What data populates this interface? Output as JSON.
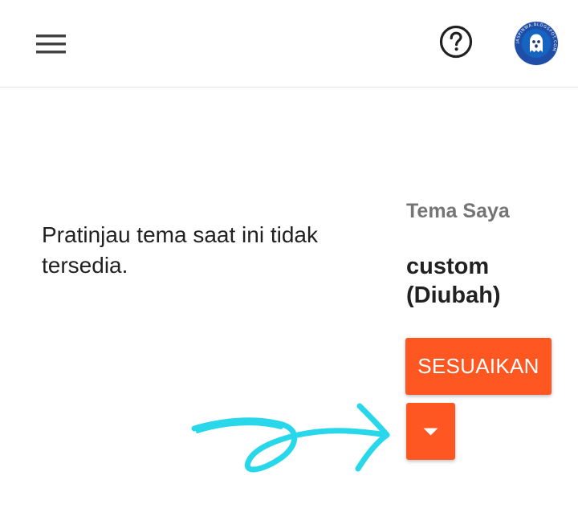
{
  "header": {
    "menu_icon": "hamburger-menu-icon",
    "help_icon": "help-circle-icon",
    "avatar": {
      "icon": "ghost-avatar-icon",
      "ring_text": "JASPINWA.BLOGSPOT.COM",
      "colors": {
        "ring": "#1e4ea8",
        "inner": "#1565c0"
      }
    }
  },
  "main": {
    "preview_message": "Pratinjau tema saat ini tidak tersedia."
  },
  "theme_panel": {
    "heading": "Tema Saya",
    "theme_name": "custom (Diubah)",
    "customize_label": "SESUAIKAN",
    "dropdown_icon": "caret-down-icon"
  },
  "annotation": {
    "icon": "hand-drawn-arrow-icon",
    "color": "#28d7ea"
  },
  "colors": {
    "accent": "#ff5722",
    "text_primary": "#212121",
    "text_secondary": "#757575",
    "icon": "#424242"
  }
}
